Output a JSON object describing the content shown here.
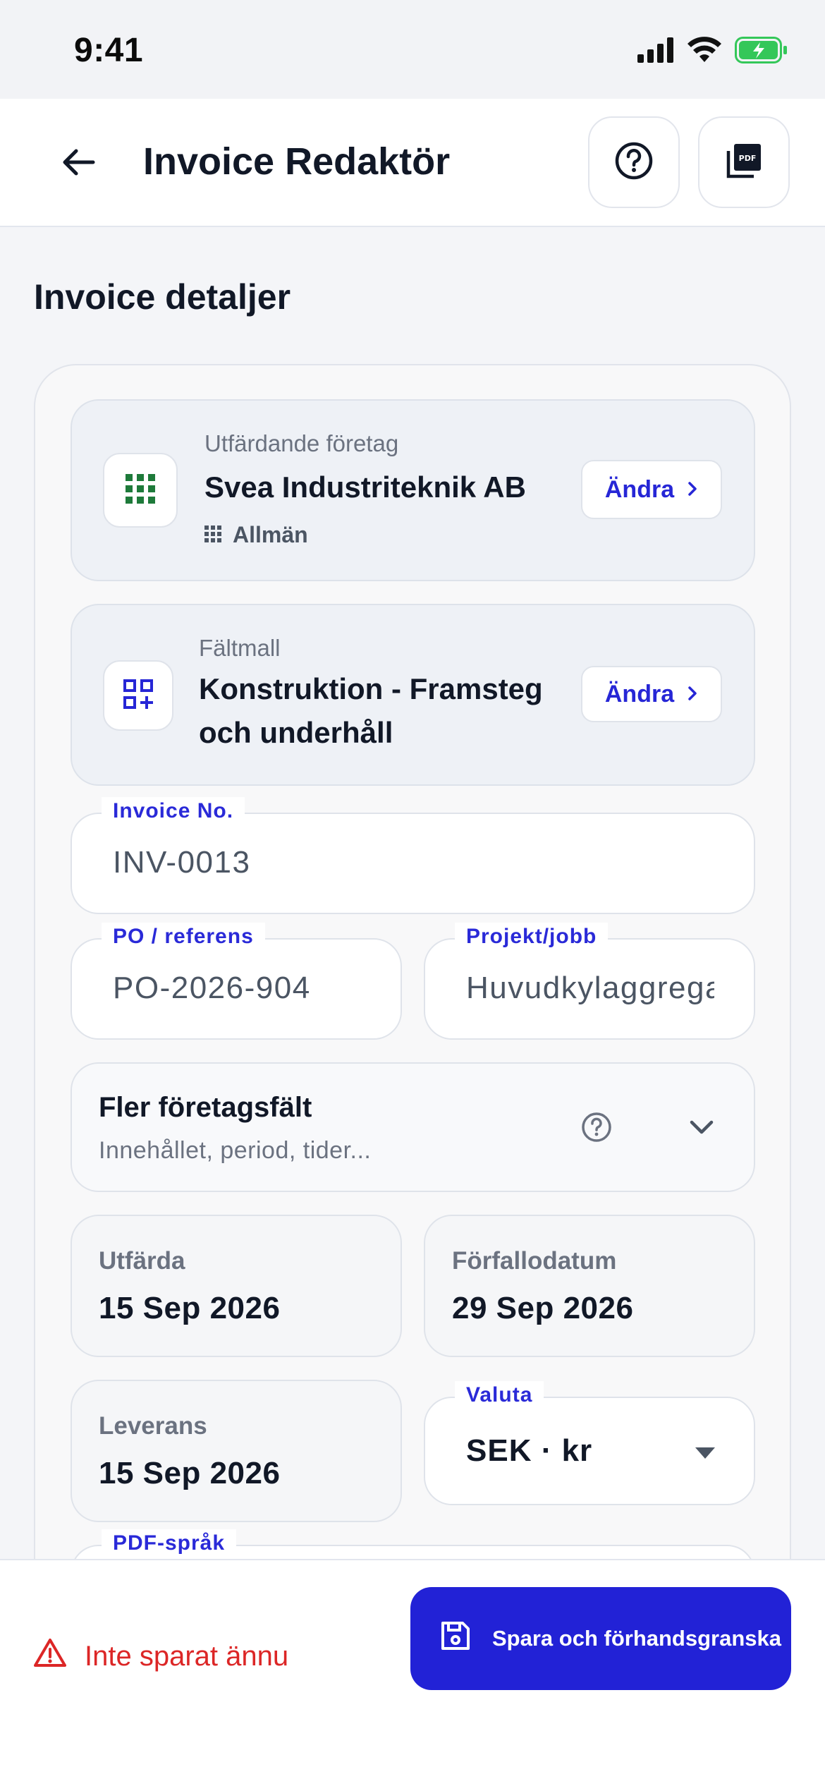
{
  "status_bar": {
    "time": "9:41"
  },
  "header": {
    "title": "Invoice Redaktör",
    "help_icon": "help-circle-icon",
    "pdf_icon": "pdf-icon"
  },
  "section": {
    "title": "Invoice detaljer"
  },
  "company": {
    "label": "Utfärdande företag",
    "name": "Svea Industriteknik AB",
    "category": "Allmän",
    "change_label": "Ändra"
  },
  "template": {
    "label": "Fältmall",
    "name_line1": "Konstruktion - Framsteg",
    "name_line2": "och underhåll",
    "change_label": "Ändra"
  },
  "fields": {
    "invoice_no": {
      "label": "Invoice No.",
      "value": "INV-0013"
    },
    "po_reference": {
      "label": "PO / referens",
      "value": "PO-2026-904"
    },
    "project": {
      "label": "Projekt/jobb",
      "value": "Huvudkylaggregat"
    }
  },
  "more_fields": {
    "title": "Fler företagsfält",
    "subtitle": "Innehållet, period, tider..."
  },
  "dates": {
    "issue": {
      "label": "Utfärda",
      "value": "15 Sep 2026"
    },
    "due": {
      "label": "Förfallodatum",
      "value": "29 Sep 2026"
    },
    "delivery": {
      "label": "Leverans",
      "value": "15 Sep 2026"
    }
  },
  "currency": {
    "label": "Valuta",
    "value": "SEK · kr"
  },
  "pdf_language": {
    "label": "PDF-språk"
  },
  "bottom": {
    "warning": "Inte sparat ännu",
    "save_label": "Spara och förhandsgranska"
  },
  "colors": {
    "accent": "#2222D6",
    "warning": "#DC2626",
    "company_icon": "#1E7A3A",
    "battery": "#34C759"
  }
}
